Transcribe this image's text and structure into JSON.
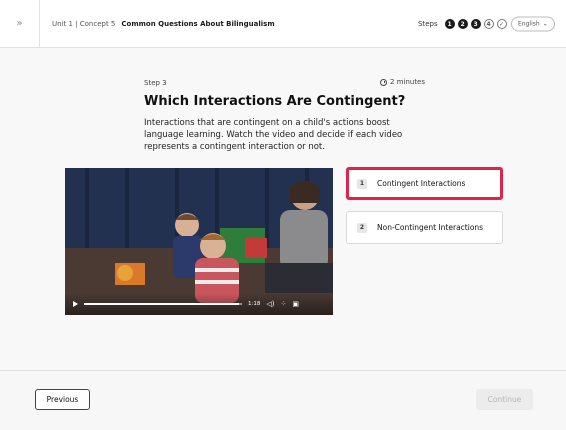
{
  "header": {
    "expand_icon": "double-chevron-right-icon",
    "expand_glyph": "»",
    "breadcrumb": "Unit 1 | Concept 5",
    "concept_title": "Common Questions About Bilingualism",
    "steps_label": "Steps",
    "steps": [
      {
        "label": "1",
        "state": "completed"
      },
      {
        "label": "2",
        "state": "completed"
      },
      {
        "label": "3",
        "state": "current"
      },
      {
        "label": "4",
        "state": "upcoming"
      },
      {
        "label": "✓",
        "state": "finish"
      }
    ],
    "language": "English"
  },
  "content": {
    "step_label": "Step 3",
    "duration": "2 minutes",
    "title": "Which Interactions Are Contingent?",
    "description": "Interactions that are contingent on a child's actions boost language learning. Watch the video and decide if each video represents a contingent interaction or not."
  },
  "video": {
    "time": "1:18",
    "progress": 0.98
  },
  "options": [
    {
      "number": "1",
      "label": "Contingent Interactions",
      "selected": true
    },
    {
      "number": "2",
      "label": "Non-Contingent Interactions",
      "selected": false
    }
  ],
  "footer": {
    "previous_label": "Previous",
    "continue_label": "Continue",
    "continue_enabled": false
  },
  "colors": {
    "selection_border": "#e0234a",
    "step_dot": "#1a1a1a"
  }
}
